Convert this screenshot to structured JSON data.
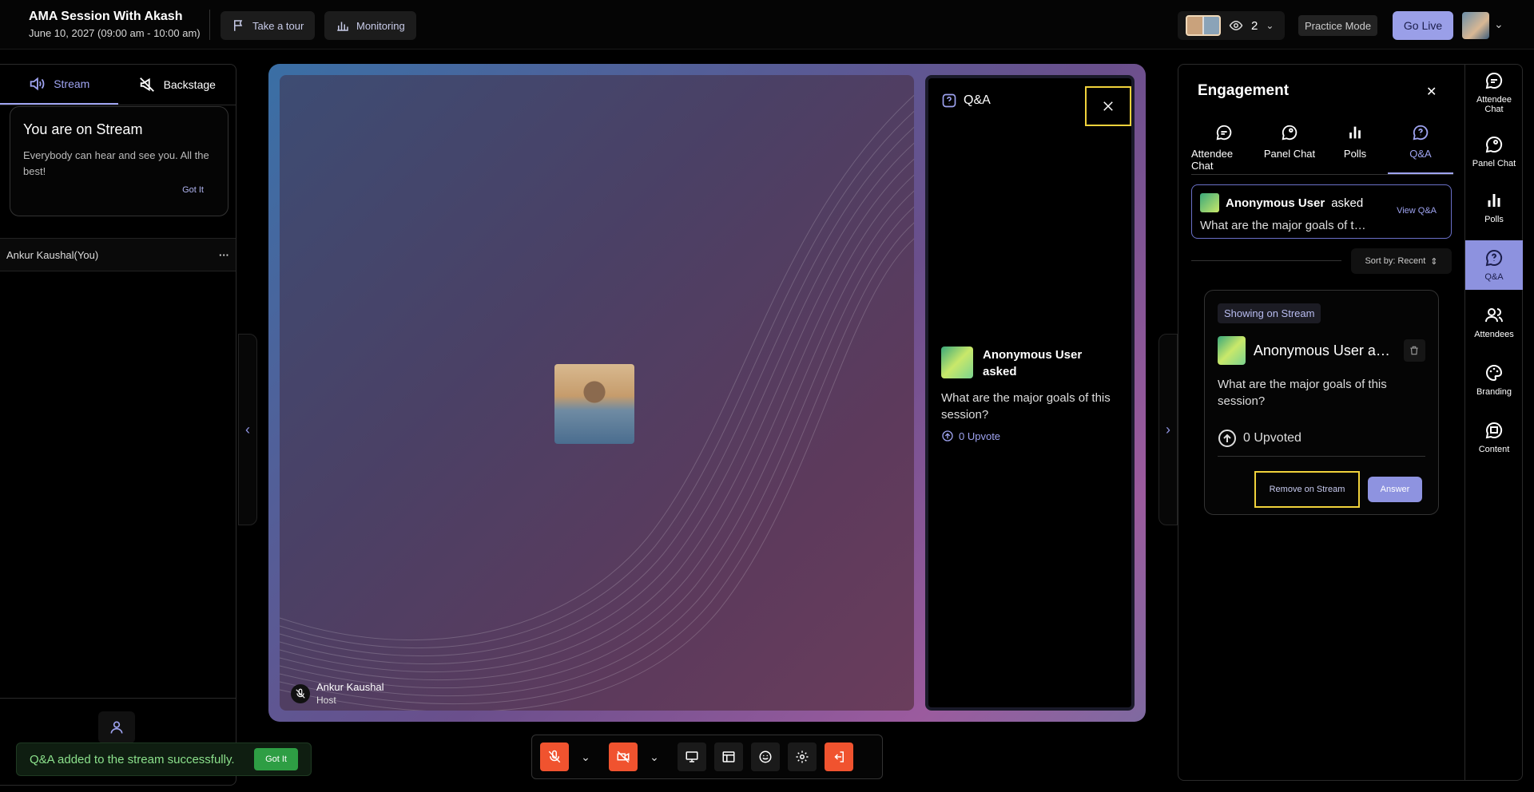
{
  "header": {
    "title": "AMA Session With Akash",
    "subtitle": "June 10, 2027 (09:00 am - 10:00 am)",
    "take_tour": "Take a tour",
    "monitoring": "Monitoring",
    "viewer_count": "2",
    "practice_mode": "Practice Mode",
    "go_live": "Go Live"
  },
  "left": {
    "tab_stream": "Stream",
    "tab_backstage": "Backstage",
    "card_title": "You are on Stream",
    "card_body": "Everybody can hear and see you. All the best!",
    "card_action": "Got It",
    "participant": "Ankur Kaushal(You)",
    "participant_menu": "···"
  },
  "toast": {
    "message": "Q&A added to the stream successfully.",
    "action": "Got It"
  },
  "stage": {
    "host_name": "Ankur Kaushal",
    "host_role": "Host",
    "qa_title": "Q&A",
    "qa_asker": "Anonymous User asked",
    "qa_question": "What are the major goals of this session?",
    "qa_upvote": "0 Upvote"
  },
  "engagement": {
    "title": "Engagement",
    "tabs": [
      {
        "label": "Attendee Chat"
      },
      {
        "label": "Panel Chat"
      },
      {
        "label": "Polls"
      },
      {
        "label": "Q&A"
      }
    ],
    "asked_user": "Anonymous User",
    "asked_suffix": "asked",
    "asked_question": "What are the major goals of this session?",
    "view_qa": "View Q&A",
    "sort": "Sort by: Recent",
    "card": {
      "badge": "Showing on Stream",
      "asker": "Anonymous User asked",
      "question": "What are the major goals of this session?",
      "upvoted": "0 Upvoted",
      "remove": "Remove on Stream",
      "answer": "Answer"
    }
  },
  "rail": [
    {
      "label": "Attendee Chat"
    },
    {
      "label": "Panel Chat"
    },
    {
      "label": "Polls"
    },
    {
      "label": "Q&A"
    },
    {
      "label": "Attendees"
    },
    {
      "label": "Branding"
    },
    {
      "label": "Content"
    }
  ],
  "colors": {
    "accent": "#9ea3f0",
    "danger": "#f0532f",
    "highlight": "#f0d23b",
    "success": "#2e9e44"
  }
}
